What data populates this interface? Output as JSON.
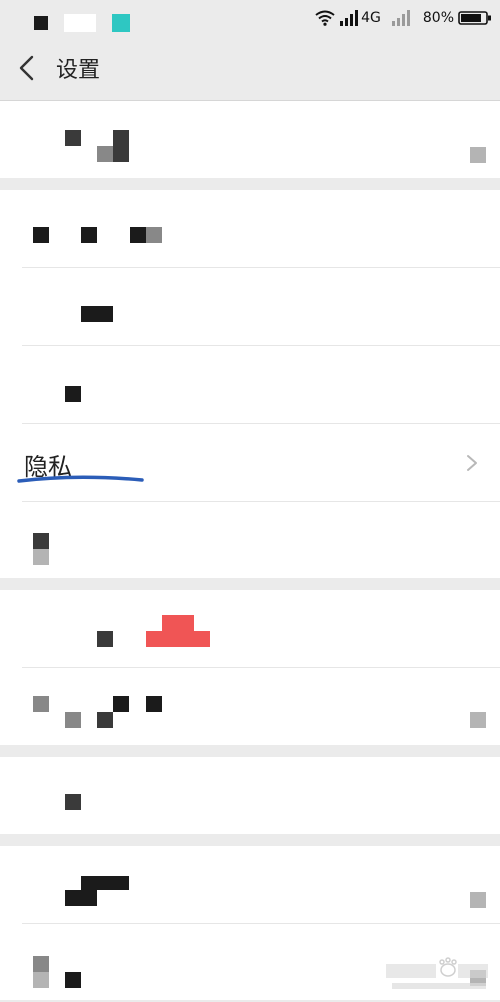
{
  "status_bar": {
    "network": "4G",
    "battery_level": "80%",
    "icons": [
      "wifi-icon",
      "signal-icon",
      "signal-icon",
      "battery-icon"
    ]
  },
  "header": {
    "title": "设置",
    "back_icon": "chevron-left-icon"
  },
  "rows": [
    {
      "label": "隐私",
      "icon": "chevron-right-icon"
    }
  ],
  "colors": {
    "background": "#ebebeb",
    "card": "#ffffff",
    "underline": "#2b5db8",
    "chevron": "#b8b8b8",
    "accent_red": "#f05555"
  }
}
